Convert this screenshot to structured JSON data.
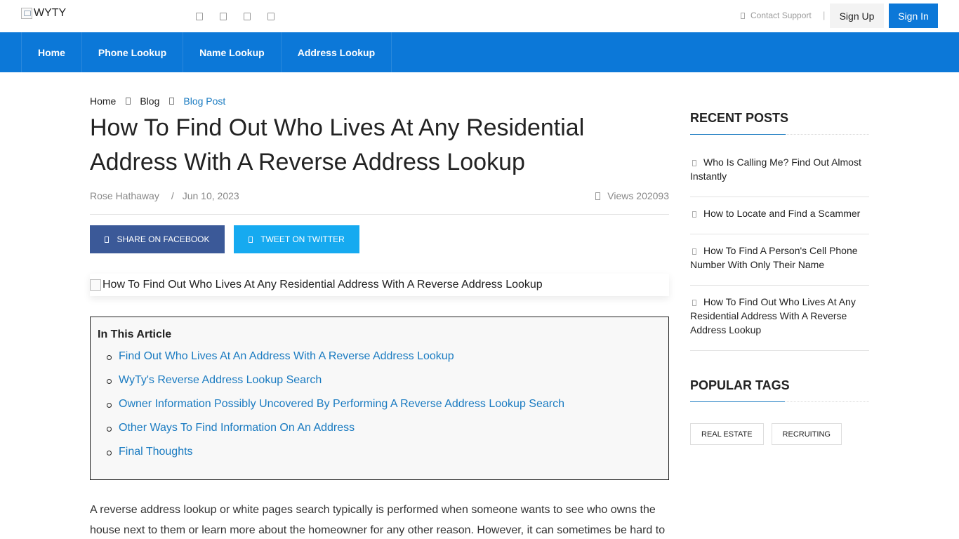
{
  "header": {
    "logo_alt": "WYTY",
    "support_label": "Contact Support",
    "signup_label": "Sign Up",
    "signin_label": "Sign In"
  },
  "nav": {
    "items": [
      "Home",
      "Phone Lookup",
      "Name Lookup",
      "Address Lookup"
    ]
  },
  "breadcrumb": {
    "items": [
      "Home",
      "Blog",
      "Blog Post"
    ]
  },
  "article": {
    "title": "How To Find Out Who Lives At Any Residential Address With A Reverse Address Lookup",
    "author": "Rose Hathaway",
    "separator": "/",
    "date": "Jun 10, 2023",
    "views": "Views 202093",
    "share_facebook": "SHARE ON FACEBOOK",
    "share_twitter": "TWEET ON TWITTER",
    "hero_alt": "How To Find Out Who Lives At Any Residential Address With A Reverse Address Lookup",
    "toc_title": "In This Article",
    "toc": [
      "Find Out Who Lives At An Address With A Reverse Address Lookup",
      "WyTy's Reverse Address Lookup Search",
      "Owner Information Possibly Uncovered By Performing A Reverse Address Lookup Search",
      "Other Ways To Find Information On An Address",
      "Final Thoughts"
    ],
    "body_text": "A reverse address lookup or white pages search typically is performed when someone wants to see who owns the house next to them or learn more about the homeowner for any other reason. However, it can sometimes be hard to"
  },
  "sidebar": {
    "recent_title": "RECENT POSTS",
    "recent_posts": [
      "Who Is Calling Me? Find Out Almost Instantly",
      "How to Locate and Find a Scammer",
      "How To Find A Person's Cell Phone Number With Only Their Name",
      "How To Find Out Who Lives At Any Residential Address With A Reverse Address Lookup"
    ],
    "tags_title": "POPULAR TAGS",
    "tags": [
      "REAL ESTATE",
      "RECRUITING"
    ]
  },
  "colors": {
    "brand_blue": "#0c78d8",
    "link_blue": "#1a7bc1",
    "facebook": "#3b5998",
    "twitter": "#16aaf0"
  },
  "icons": {
    "social": [
      "facebook-icon",
      "twitter-icon",
      "linkedin-icon",
      "instagram-icon"
    ]
  }
}
